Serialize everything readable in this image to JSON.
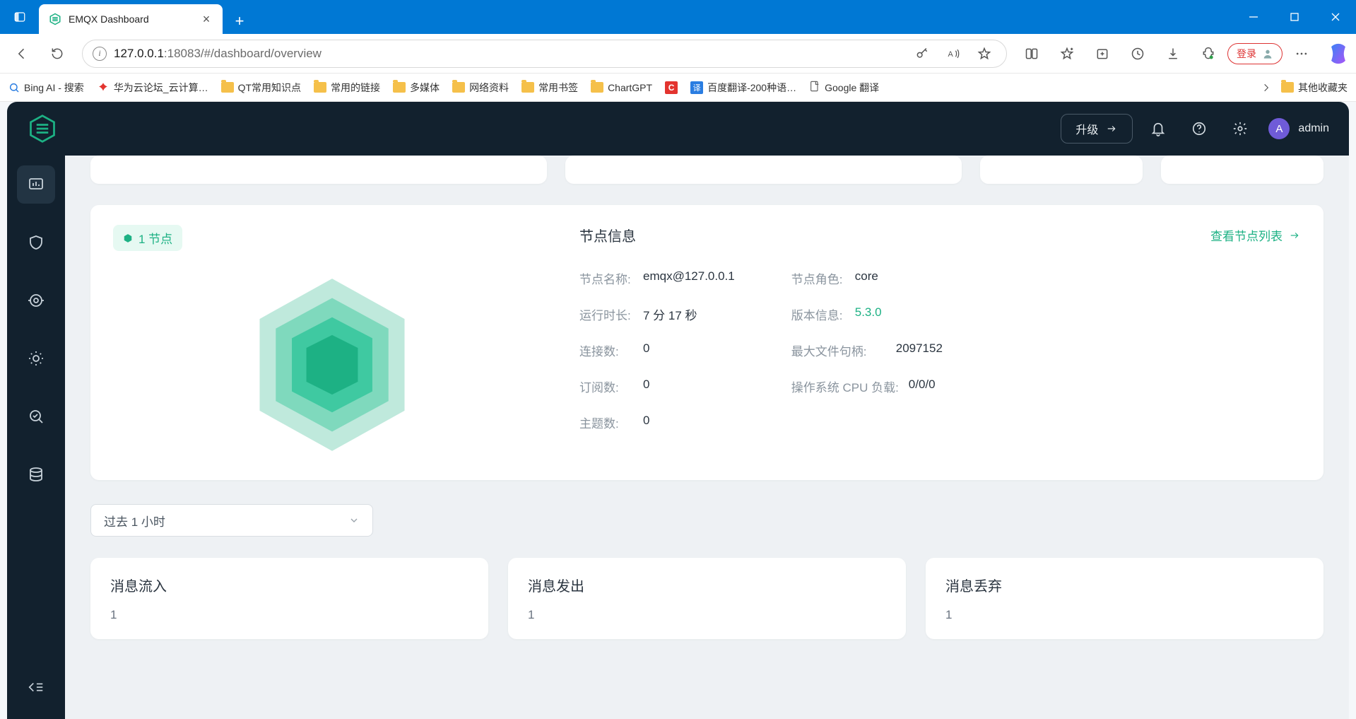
{
  "browser": {
    "tab_title": "EMQX Dashboard",
    "url_full": "127.0.0.1:18083/#/dashboard/overview",
    "login_label": "登录",
    "bookmarks": {
      "bing": "Bing AI - 搜索",
      "huawei": "华为云论坛_云计算…",
      "qt": "QT常用知识点",
      "links": "常用的链接",
      "media": "多媒体",
      "net": "网络资料",
      "bm": "常用书签",
      "chartgpt": "ChartGPT",
      "baidu": "百度翻译-200种语…",
      "google": "Google 翻译",
      "other": "其他收藏夹"
    }
  },
  "app": {
    "upgrade_label": "升级",
    "username": "admin",
    "node_badge": "1 节点",
    "node_info_title": "节点信息",
    "node_list_link": "查看节点列表",
    "left": {
      "name_label": "节点名称:",
      "name_value": "emqx@127.0.0.1",
      "uptime_label": "运行时长:",
      "uptime_value": "7 分 17 秒",
      "conn_label": "连接数:",
      "conn_value": "0",
      "sub_label": "订阅数:",
      "sub_value": "0",
      "topic_label": "主题数:",
      "topic_value": "0"
    },
    "right": {
      "role_label": "节点角色:",
      "role_value": "core",
      "version_label": "版本信息:",
      "version_value": "5.3.0",
      "fd_label": "最大文件句柄:",
      "fd_value": "2097152",
      "cpu_label": "操作系统 CPU 负载:",
      "cpu_value": "0/0/0"
    },
    "range_label": "过去 1 小时",
    "metrics": {
      "in_title": "消息流入",
      "in_val": "1",
      "out_title": "消息发出",
      "out_val": "1",
      "drop_title": "消息丢弃",
      "drop_val": "1"
    }
  }
}
